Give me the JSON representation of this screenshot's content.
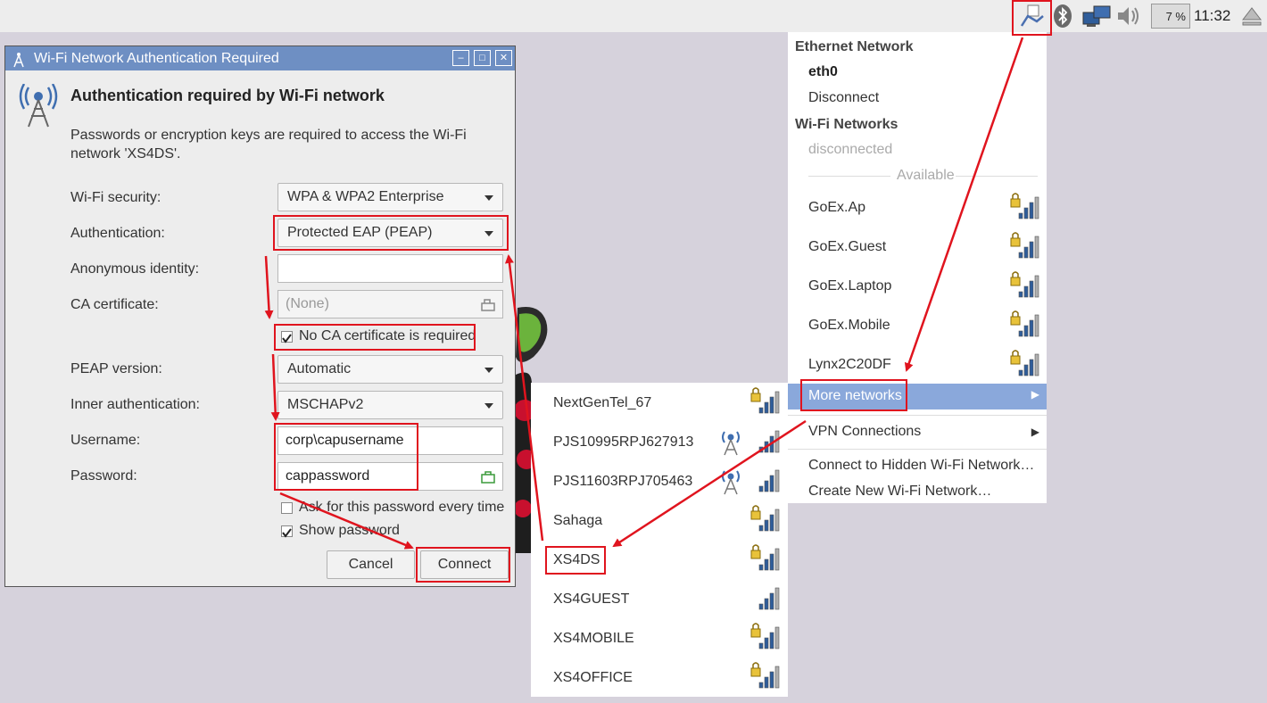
{
  "taskbar": {
    "cpu": "7 %",
    "clock": "11:32",
    "icons": [
      "network-icon",
      "bluetooth-icon",
      "monitor-icon",
      "volume-icon",
      "eject-icon"
    ]
  },
  "dialog": {
    "title": "Wi-Fi Network Authentication Required",
    "heading": "Authentication required by Wi-Fi network",
    "description": "Passwords or encryption keys are required to access the Wi-Fi network 'XS4DS'.",
    "wifi_security_label": "Wi-Fi security:",
    "wifi_security_value": "WPA & WPA2 Enterprise",
    "authentication_label": "Authentication:",
    "authentication_value": "Protected EAP (PEAP)",
    "anonymous_identity_label": "Anonymous identity:",
    "anonymous_identity_value": "",
    "ca_certificate_label": "CA certificate:",
    "ca_certificate_value": "(None)",
    "no_ca_label": "No CA certificate is required",
    "peap_version_label": "PEAP version:",
    "peap_version_value": "Automatic",
    "inner_auth_label": "Inner authentication:",
    "inner_auth_value": "MSCHAPv2",
    "username_label": "Username:",
    "username_value": "corp\\capusername",
    "password_label": "Password:",
    "password_value": "cappassword",
    "ask_password_label": "Ask for this password every time",
    "show_password_label": "Show password",
    "cancel_label": "Cancel",
    "connect_label": "Connect"
  },
  "network_menu": {
    "ethernet_header": "Ethernet Network",
    "eth0": "eth0",
    "disconnect": "Disconnect",
    "wifi_header": "Wi-Fi Networks",
    "wifi_status": "disconnected",
    "available": "Available",
    "networks": [
      "GoEx.Ap",
      "GoEx.Guest",
      "GoEx.Laptop",
      "GoEx.Mobile",
      "Lynx2C20DF"
    ],
    "more_networks": "More networks",
    "vpn": "VPN Connections",
    "hidden": "Connect to Hidden Wi-Fi Network…",
    "create": "Create New Wi-Fi Network…"
  },
  "submenu": {
    "networks": [
      "NextGenTel_67",
      "PJS10995RPJ627913",
      "PJS11603RPJ705463",
      "Sahaga",
      "XS4DS",
      "XS4GUEST",
      "XS4MOBILE",
      "XS4OFFICE"
    ]
  },
  "colors": {
    "highlight": "#8aa8db",
    "annotation": "#e0141e",
    "titlebar": "#6e8fc3"
  }
}
